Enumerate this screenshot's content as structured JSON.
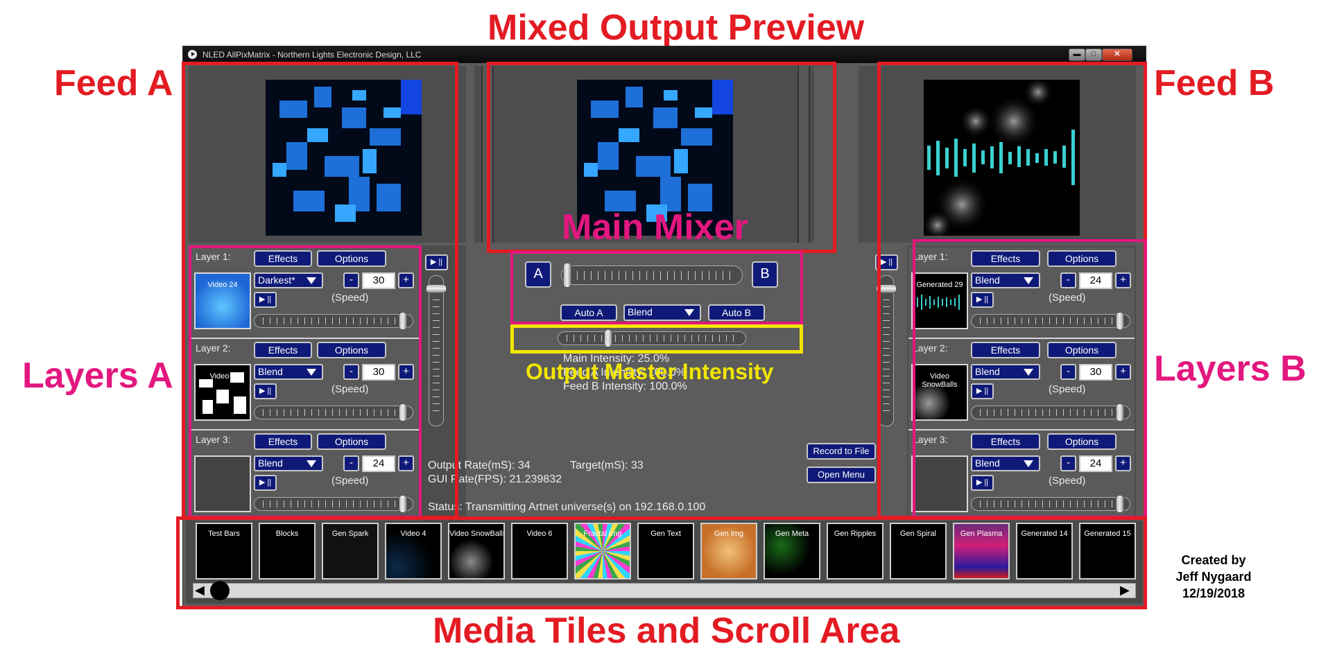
{
  "annotations": {
    "mixed_output_preview": "Mixed Output Preview",
    "feed_a": "Feed A",
    "feed_b": "Feed B",
    "main_mixer": "Main Mixer",
    "layers_a": "Layers A",
    "layers_b": "Layers B",
    "output_master_intensity": "Output Master Intensity",
    "media_tiles": "Media Tiles and Scroll Area",
    "credit": [
      "Created by",
      "Jeff Nygaard",
      "12/19/2018"
    ]
  },
  "window": {
    "title": "NLED AllPixMatrix - Northern Lights Electronic Design, LLC",
    "minimize": "▬",
    "maximize": "□",
    "close": "✕"
  },
  "layers_a": [
    {
      "label": "Layer 1:",
      "effects": "Effects",
      "options": "Options",
      "thumb": "Video 24",
      "blend": "Darkest*",
      "value": "30",
      "speed_label": "(Speed)",
      "speed_level": 0.97
    },
    {
      "label": "Layer 2:",
      "effects": "Effects",
      "options": "Options",
      "thumb": "Video 6",
      "blend": "Blend",
      "value": "30",
      "speed_label": "(Speed)",
      "speed_level": 0.97
    },
    {
      "label": "Layer 3:",
      "effects": "Effects",
      "options": "Options",
      "thumb": "",
      "blend": "Blend",
      "value": "24",
      "speed_label": "(Speed)",
      "speed_level": 0.97
    }
  ],
  "layers_b": [
    {
      "label": "Layer 1:",
      "effects": "Effects",
      "options": "Options",
      "thumb": "Generated 29",
      "blend": "Blend",
      "value": "24",
      "speed_label": "(Speed)",
      "speed_level": 0.97
    },
    {
      "label": "Layer 2:",
      "effects": "Effects",
      "options": "Options",
      "thumb": "Video SnowBalls",
      "blend": "Blend",
      "value": "30",
      "speed_label": "(Speed)",
      "speed_level": 0.97
    },
    {
      "label": "Layer 3:",
      "effects": "Effects",
      "options": "Options",
      "thumb": "",
      "blend": "Blend",
      "value": "24",
      "speed_label": "(Speed)",
      "speed_level": 0.97
    }
  ],
  "common": {
    "minus": "-",
    "plus": "+",
    "play_pause": "▶ ||"
  },
  "mixer": {
    "a_label": "A",
    "b_label": "B",
    "crossfade_level": 0.0,
    "auto_a": "Auto A",
    "auto_b": "Auto B",
    "blend": "Blend",
    "master_level": 0.25
  },
  "feed_a_intensity_level": 0.95,
  "feed_b_intensity_level": 0.95,
  "status": {
    "main_intensity": "Main Intensity: 25.0%",
    "feed_a_intensity": "Feed A Intensity: 100.0%",
    "feed_b_intensity": "Feed B Intensity: 100.0%",
    "output_rate": "Output Rate(mS): 34",
    "target": "Target(mS): 33",
    "gui_rate": "GUI Rate(FPS): 21.239832",
    "status_line": "Status: Transmitting Artnet universe(s) on 192.168.0.100",
    "record": "Record to File",
    "open_menu": "Open Menu"
  },
  "media_tiles": [
    {
      "label": "Test Bars"
    },
    {
      "label": "Blocks"
    },
    {
      "label": "Gen Spark"
    },
    {
      "label": "Video 4"
    },
    {
      "label": "Video SnowBalls"
    },
    {
      "label": "Video 6"
    },
    {
      "label": "Fractal Img"
    },
    {
      "label": "Gen Text"
    },
    {
      "label": "Gen Img"
    },
    {
      "label": "Gen Meta"
    },
    {
      "label": "Gen Ripples"
    },
    {
      "label": "Gen Spiral"
    },
    {
      "label": "Gen Plasma"
    },
    {
      "label": "Generated 14"
    },
    {
      "label": "Generated 15"
    }
  ],
  "scroll": {
    "left": "◀",
    "right": "▶"
  },
  "colors": {
    "accent_red": "#e31b23",
    "accent_pink": "#e3177f",
    "accent_yellow": "#f2e600",
    "button_navy": "#0f1a78"
  }
}
